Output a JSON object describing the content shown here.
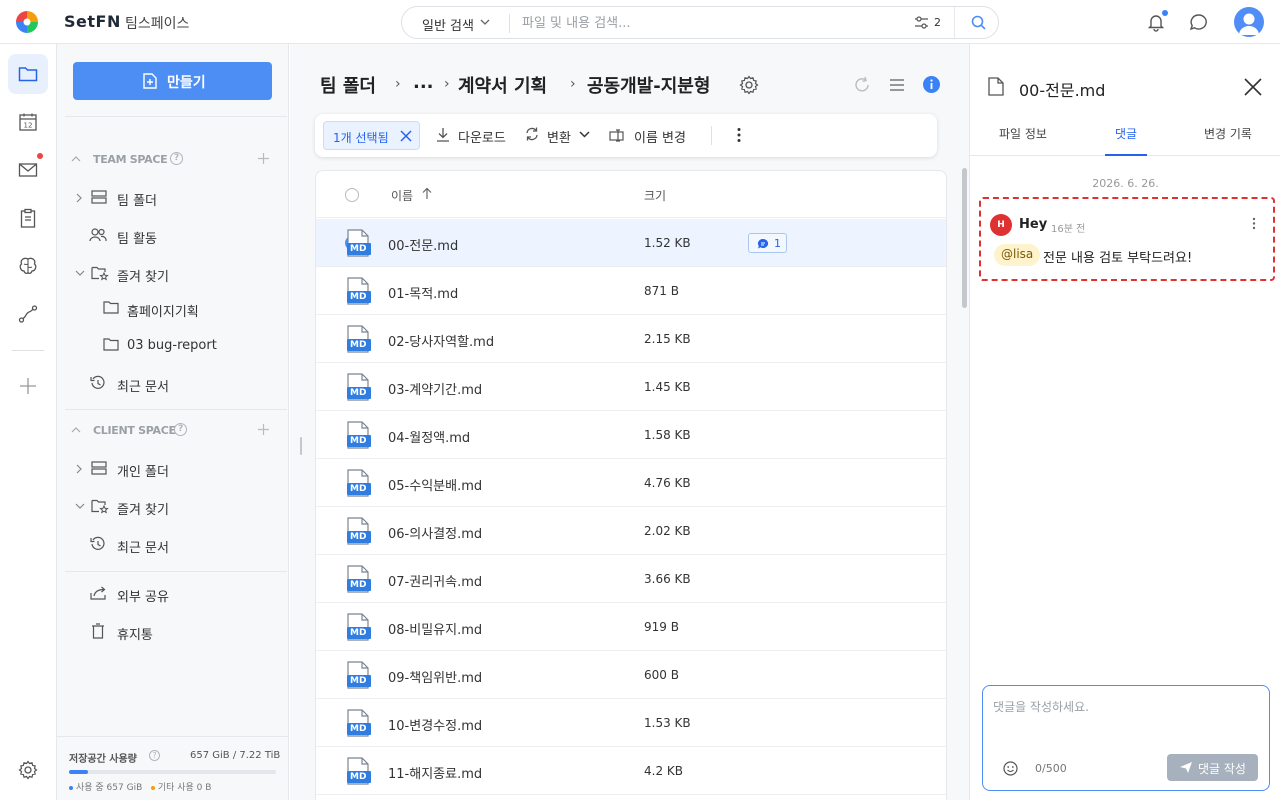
{
  "app": {
    "brand": "SetFN",
    "workspace": "팀스페이스"
  },
  "search": {
    "type_label": "일반 검색",
    "placeholder": "파일 및 내용 검색...",
    "filter_count": "2"
  },
  "sidebar": {
    "create_label": "만들기",
    "team_space": {
      "title": "TEAM SPACE",
      "items": [
        {
          "label": "팀 폴더"
        },
        {
          "label": "팀 활동"
        },
        {
          "label": "즐겨 찾기"
        },
        {
          "label": "홈페이지기획"
        },
        {
          "label": "03 bug-report"
        },
        {
          "label": "최근 문서"
        }
      ]
    },
    "client_space": {
      "title": "CLIENT SPACE",
      "items": [
        {
          "label": "개인 폴더"
        },
        {
          "label": "즐겨 찾기"
        },
        {
          "label": "최근 문서"
        }
      ]
    },
    "extra": {
      "share": "외부 공유",
      "trash": "휴지통"
    },
    "storage": {
      "title": "저장공간 사용량",
      "total": "657 GiB / 7.22 TiB",
      "used_fraction": 0.09,
      "used_label": "사용 중 657 GiB",
      "other_label": "기타 사용 0 B"
    }
  },
  "main": {
    "breadcrumb": [
      "팀 폴더",
      "...",
      "계약서 기획",
      "공동개발-지분형"
    ],
    "actions": {
      "selected": "1개 선택됨",
      "download": "다운로드",
      "convert": "변환",
      "rename": "이름 변경"
    },
    "columns": {
      "name": "이름",
      "size": "크기"
    },
    "files": [
      {
        "name": "00-전문.md",
        "size": "1.52 KB",
        "comments": "1",
        "selected": true
      },
      {
        "name": "01-목적.md",
        "size": "871 B"
      },
      {
        "name": "02-당사자역할.md",
        "size": "2.15 KB"
      },
      {
        "name": "03-계약기간.md",
        "size": "1.45 KB"
      },
      {
        "name": "04-월정액.md",
        "size": "1.58 KB"
      },
      {
        "name": "05-수익분배.md",
        "size": "4.76 KB"
      },
      {
        "name": "06-의사결정.md",
        "size": "2.02 KB"
      },
      {
        "name": "07-권리귀속.md",
        "size": "3.66 KB"
      },
      {
        "name": "08-비밀유지.md",
        "size": "919 B"
      },
      {
        "name": "09-책임위반.md",
        "size": "600 B"
      },
      {
        "name": "10-변경수정.md",
        "size": "1.53 KB"
      },
      {
        "name": "11-해지종료.md",
        "size": "4.2 KB"
      }
    ],
    "file_icon_text": "MD"
  },
  "panel": {
    "title": "00-전문.md",
    "tabs": [
      "파일 정보",
      "댓글",
      "변경 기록"
    ],
    "comment": {
      "date": "2026. 6. 26.",
      "avatar_initial": "H",
      "author": "Hey",
      "time": "16분 전",
      "mention": "@lisa",
      "text": "전문 내용 검토 부탁드려요!"
    },
    "input": {
      "placeholder": "댓글을 작성하세요.",
      "count": "0/500",
      "submit": "댓글 작성"
    }
  },
  "colors": {
    "accent": "#4d8ef5",
    "selected_row": "#eef4ff",
    "highlight_border": "#e03131"
  }
}
